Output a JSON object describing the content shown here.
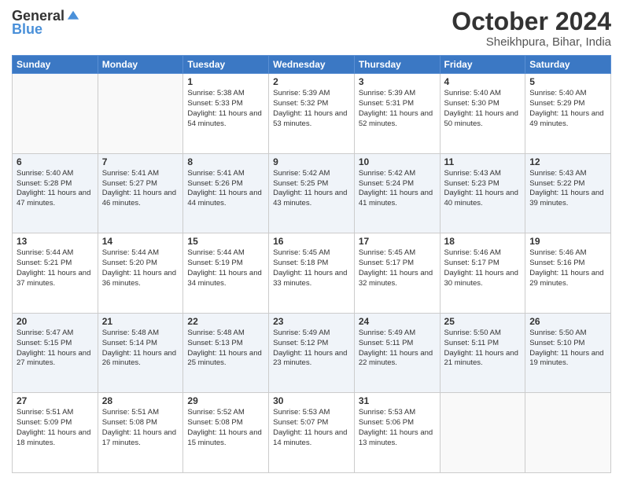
{
  "header": {
    "logo_general": "General",
    "logo_blue": "Blue",
    "month": "October 2024",
    "location": "Sheikhpura, Bihar, India"
  },
  "weekdays": [
    "Sunday",
    "Monday",
    "Tuesday",
    "Wednesday",
    "Thursday",
    "Friday",
    "Saturday"
  ],
  "weeks": [
    [
      {
        "day": "",
        "info": ""
      },
      {
        "day": "",
        "info": ""
      },
      {
        "day": "1",
        "info": "Sunrise: 5:38 AM\nSunset: 5:33 PM\nDaylight: 11 hours and 54 minutes."
      },
      {
        "day": "2",
        "info": "Sunrise: 5:39 AM\nSunset: 5:32 PM\nDaylight: 11 hours and 53 minutes."
      },
      {
        "day": "3",
        "info": "Sunrise: 5:39 AM\nSunset: 5:31 PM\nDaylight: 11 hours and 52 minutes."
      },
      {
        "day": "4",
        "info": "Sunrise: 5:40 AM\nSunset: 5:30 PM\nDaylight: 11 hours and 50 minutes."
      },
      {
        "day": "5",
        "info": "Sunrise: 5:40 AM\nSunset: 5:29 PM\nDaylight: 11 hours and 49 minutes."
      }
    ],
    [
      {
        "day": "6",
        "info": "Sunrise: 5:40 AM\nSunset: 5:28 PM\nDaylight: 11 hours and 47 minutes."
      },
      {
        "day": "7",
        "info": "Sunrise: 5:41 AM\nSunset: 5:27 PM\nDaylight: 11 hours and 46 minutes."
      },
      {
        "day": "8",
        "info": "Sunrise: 5:41 AM\nSunset: 5:26 PM\nDaylight: 11 hours and 44 minutes."
      },
      {
        "day": "9",
        "info": "Sunrise: 5:42 AM\nSunset: 5:25 PM\nDaylight: 11 hours and 43 minutes."
      },
      {
        "day": "10",
        "info": "Sunrise: 5:42 AM\nSunset: 5:24 PM\nDaylight: 11 hours and 41 minutes."
      },
      {
        "day": "11",
        "info": "Sunrise: 5:43 AM\nSunset: 5:23 PM\nDaylight: 11 hours and 40 minutes."
      },
      {
        "day": "12",
        "info": "Sunrise: 5:43 AM\nSunset: 5:22 PM\nDaylight: 11 hours and 39 minutes."
      }
    ],
    [
      {
        "day": "13",
        "info": "Sunrise: 5:44 AM\nSunset: 5:21 PM\nDaylight: 11 hours and 37 minutes."
      },
      {
        "day": "14",
        "info": "Sunrise: 5:44 AM\nSunset: 5:20 PM\nDaylight: 11 hours and 36 minutes."
      },
      {
        "day": "15",
        "info": "Sunrise: 5:44 AM\nSunset: 5:19 PM\nDaylight: 11 hours and 34 minutes."
      },
      {
        "day": "16",
        "info": "Sunrise: 5:45 AM\nSunset: 5:18 PM\nDaylight: 11 hours and 33 minutes."
      },
      {
        "day": "17",
        "info": "Sunrise: 5:45 AM\nSunset: 5:17 PM\nDaylight: 11 hours and 32 minutes."
      },
      {
        "day": "18",
        "info": "Sunrise: 5:46 AM\nSunset: 5:17 PM\nDaylight: 11 hours and 30 minutes."
      },
      {
        "day": "19",
        "info": "Sunrise: 5:46 AM\nSunset: 5:16 PM\nDaylight: 11 hours and 29 minutes."
      }
    ],
    [
      {
        "day": "20",
        "info": "Sunrise: 5:47 AM\nSunset: 5:15 PM\nDaylight: 11 hours and 27 minutes."
      },
      {
        "day": "21",
        "info": "Sunrise: 5:48 AM\nSunset: 5:14 PM\nDaylight: 11 hours and 26 minutes."
      },
      {
        "day": "22",
        "info": "Sunrise: 5:48 AM\nSunset: 5:13 PM\nDaylight: 11 hours and 25 minutes."
      },
      {
        "day": "23",
        "info": "Sunrise: 5:49 AM\nSunset: 5:12 PM\nDaylight: 11 hours and 23 minutes."
      },
      {
        "day": "24",
        "info": "Sunrise: 5:49 AM\nSunset: 5:11 PM\nDaylight: 11 hours and 22 minutes."
      },
      {
        "day": "25",
        "info": "Sunrise: 5:50 AM\nSunset: 5:11 PM\nDaylight: 11 hours and 21 minutes."
      },
      {
        "day": "26",
        "info": "Sunrise: 5:50 AM\nSunset: 5:10 PM\nDaylight: 11 hours and 19 minutes."
      }
    ],
    [
      {
        "day": "27",
        "info": "Sunrise: 5:51 AM\nSunset: 5:09 PM\nDaylight: 11 hours and 18 minutes."
      },
      {
        "day": "28",
        "info": "Sunrise: 5:51 AM\nSunset: 5:08 PM\nDaylight: 11 hours and 17 minutes."
      },
      {
        "day": "29",
        "info": "Sunrise: 5:52 AM\nSunset: 5:08 PM\nDaylight: 11 hours and 15 minutes."
      },
      {
        "day": "30",
        "info": "Sunrise: 5:53 AM\nSunset: 5:07 PM\nDaylight: 11 hours and 14 minutes."
      },
      {
        "day": "31",
        "info": "Sunrise: 5:53 AM\nSunset: 5:06 PM\nDaylight: 11 hours and 13 minutes."
      },
      {
        "day": "",
        "info": ""
      },
      {
        "day": "",
        "info": ""
      }
    ]
  ]
}
